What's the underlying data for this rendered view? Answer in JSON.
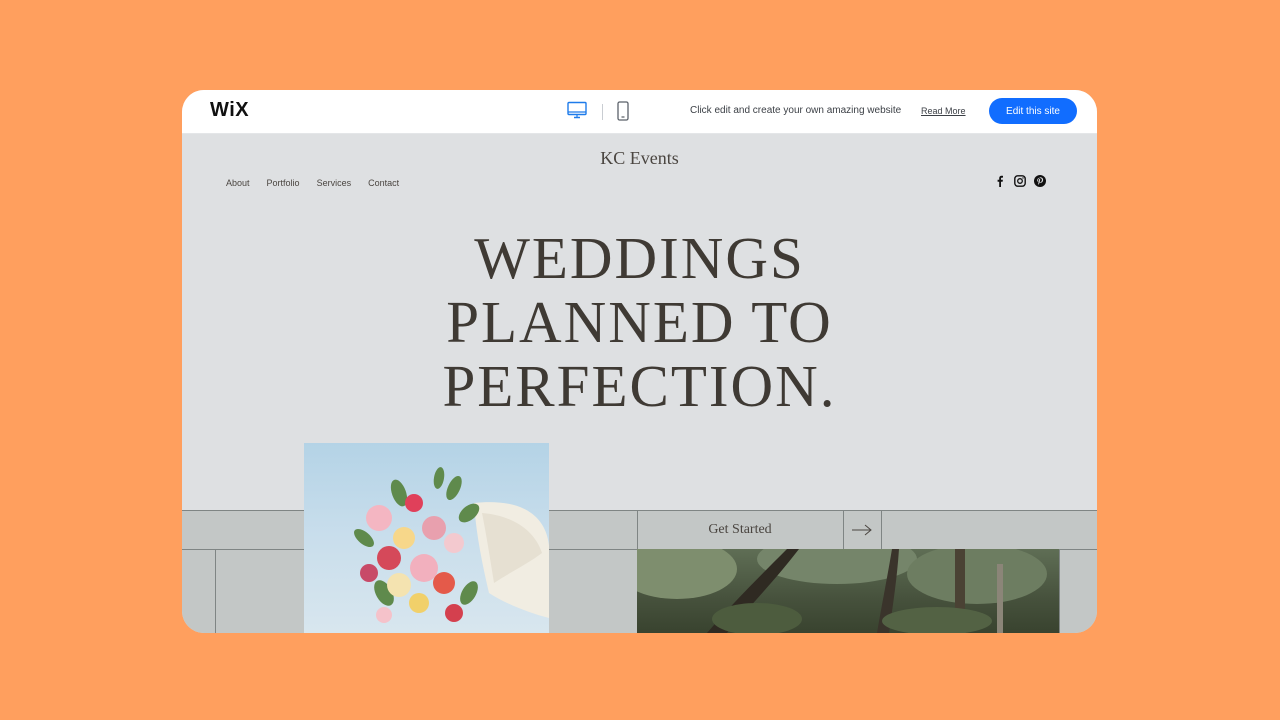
{
  "wix_bar": {
    "logo": "WiX",
    "message": "Click edit and create your own amazing website",
    "read_more": "Read More",
    "edit_button": "Edit this site"
  },
  "site": {
    "title": "KC Events",
    "nav": [
      "About",
      "Portfolio",
      "Services",
      "Contact"
    ],
    "social": [
      "facebook-icon",
      "instagram-icon",
      "pinterest-icon"
    ],
    "hero_lines": [
      "WEDDINGS",
      "PLANNED TO",
      "PERFECTION."
    ],
    "cta_label": "Get Started"
  },
  "colors": {
    "background": "#FF9F5E",
    "page": "#DEE0E2",
    "band": "#C3C7C6",
    "accent": "#116DFF",
    "text": "#3F3A34"
  }
}
